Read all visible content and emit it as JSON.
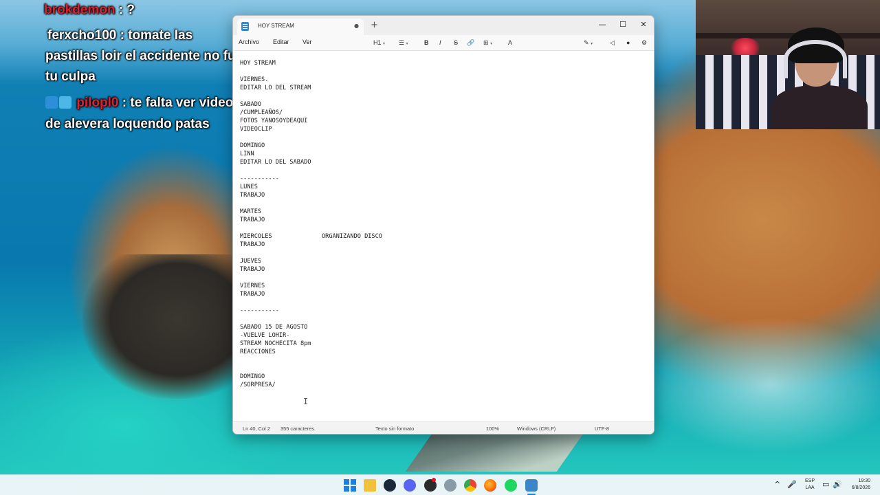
{
  "chat": {
    "messages": [
      {
        "user": "brokdemon",
        "text": " : ?"
      },
      {
        "user": "ferxcho100",
        "text": " : tomate las pastillas loir el accidente no fue tu culpa"
      },
      {
        "user": "pilopl0",
        "text": " : te falta ver videos de alevera loquendo patas"
      }
    ],
    "line1": "brokdemon",
    "line1_rest": " : ?",
    "line2a": "ferxcho100 : tomate las",
    "line2b": "pastillas loir el accidente no fue",
    "line2c": "tu culpa",
    "line3_user": "pilopl0",
    "line3_rest": " : te falta ver videos",
    "line3b": "de alevera loquendo patas",
    "user_color_red": "#e01e2e"
  },
  "notepad": {
    "tab_title": "HOY STREAM",
    "tab_modified_glyph": "●",
    "new_tab_glyph": "+",
    "window_controls": {
      "minimize": "—",
      "maximize": "☐",
      "close": "✕"
    },
    "menu": {
      "file": "Archivo",
      "edit": "Editar",
      "view": "Ver"
    },
    "toolbar": {
      "heading": "H1",
      "heading_caret": "▾",
      "list": "☰",
      "list_caret": "▾",
      "bold": "B",
      "italic": "I",
      "strike": "S",
      "link": "🔗",
      "table": "⊞",
      "table_caret": "▾",
      "spell": "A",
      "copilot": "✎",
      "copilot_caret": "▾",
      "announce": "◁",
      "account": "●",
      "settings": "⚙"
    },
    "content": "HOY STREAM\n\nVIERNES.\nEDITAR LO DEL STREAM\n\nSABADO\n/CUMPLEAÑOS/\nFOTOS YANOSOYDEAQUI\nVIDEOCLIP\n\nDOMINGO\nLINN\nEDITAR LO DEL SABADO\n\n-----------\nLUNES\nTRABAJO\n\nMARTES\nTRABAJO\n\nMIERCOLES              ORGANIZANDO DISCO\nTRABAJO\n\nJUEVES\nTRABAJO\n\nVIERNES\nTRABAJO\n\n-----------\n\nSABADO 15 DE AGOSTO\n-VUELVE LOHIR-\nSTREAM NOCHECITA 8pm\nREACCIONES\n\n\nDOMINGO\n/SORPRESA/",
    "text_cursor_glyph": "I",
    "status": {
      "position": "Ln 40, Col 2",
      "chars": "355 caracteres.",
      "format": "Texto sin formato",
      "zoom": "100%",
      "line_ending": "Windows (CRLF)",
      "encoding": "UTF-8"
    }
  },
  "taskbar": {
    "apps": [
      "start-icon",
      "file-explorer-icon",
      "steam-icon",
      "discord-icon",
      "obs-icon",
      "edge-icon",
      "chrome-icon",
      "firefox-icon",
      "spotify-icon",
      "notepad-icon"
    ],
    "tray": {
      "chevron": "^",
      "mic": "🎤",
      "lang_line1": "ESP",
      "lang_line2": "LAA",
      "network": "▭",
      "volume": "🔊",
      "time": "19:30",
      "date": "6/8/2026"
    }
  }
}
